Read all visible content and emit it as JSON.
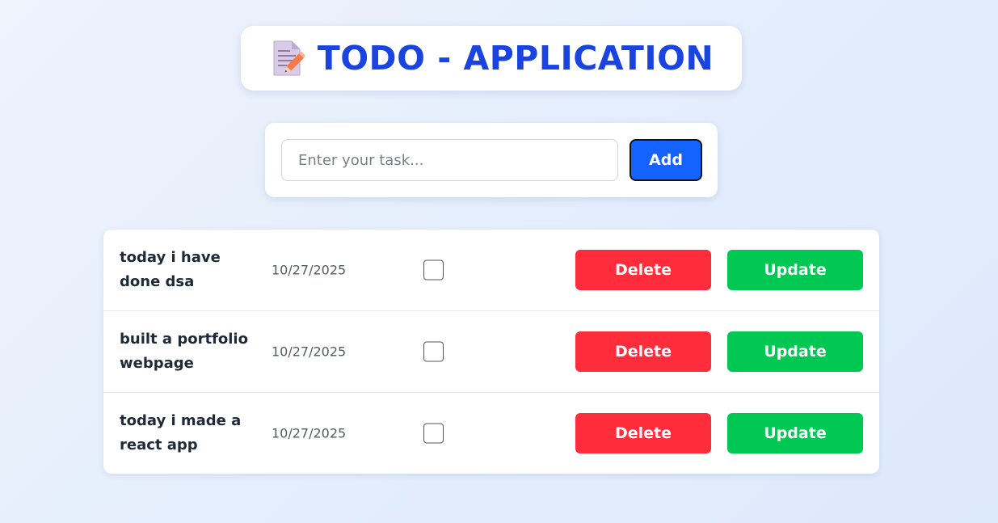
{
  "header": {
    "icon": "memo-icon",
    "title": "TODO - APPLICATION",
    "title_color": "#1a44e0"
  },
  "form": {
    "input_value": "",
    "input_placeholder": "Enter your task...",
    "add_label": "Add",
    "add_color": "#1563ff"
  },
  "todos": [
    {
      "text": "today i have done dsa",
      "date": "10/27/2025",
      "completed": false,
      "delete_label": "Delete",
      "update_label": "Update"
    },
    {
      "text": "built a portfolio webpage",
      "date": "10/27/2025",
      "completed": false,
      "delete_label": "Delete",
      "update_label": "Update"
    },
    {
      "text": "today i made a react app",
      "date": "10/27/2025",
      "completed": false,
      "delete_label": "Delete",
      "update_label": "Update"
    }
  ],
  "colors": {
    "delete": "#ff2d3c",
    "update": "#00c853"
  }
}
